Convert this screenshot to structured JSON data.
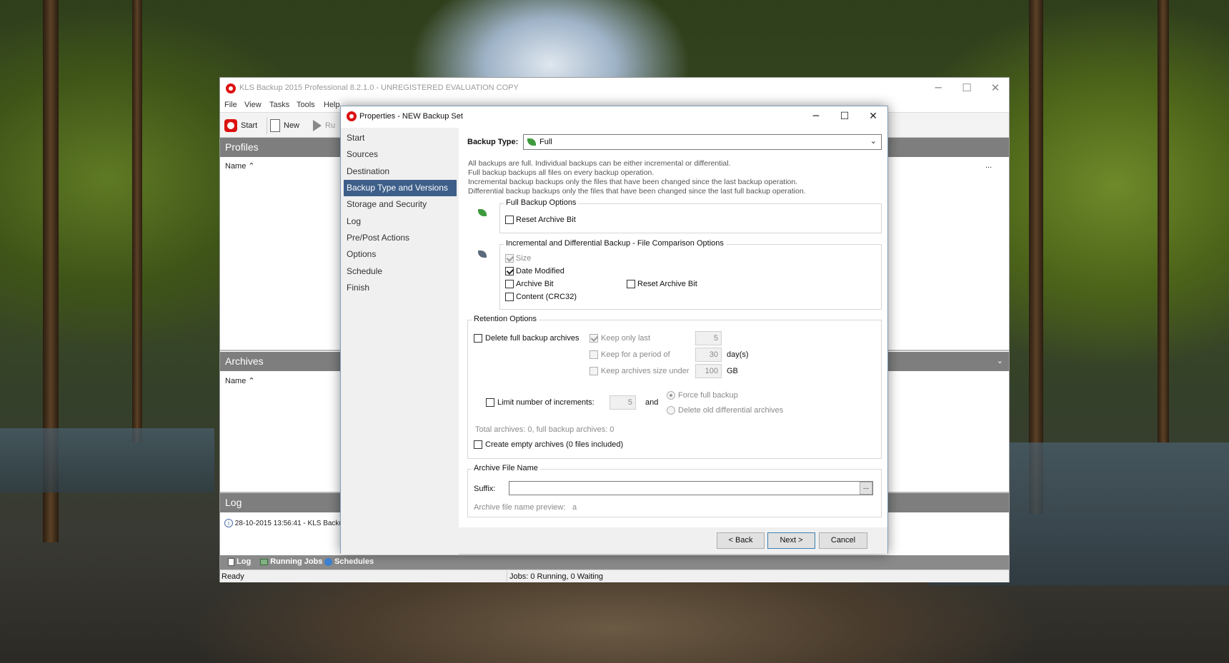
{
  "main_window": {
    "title": "KLS Backup 2015 Professional 8.2.1.0 - UNREGISTERED EVALUATION COPY",
    "menu": [
      "File",
      "View",
      "Tasks",
      "Tools",
      "Help"
    ],
    "toolbar": {
      "start": "Start",
      "new": "New",
      "run": "Ru"
    },
    "profiles": {
      "header": "Profiles",
      "column": "Name",
      "ellipsis": "..."
    },
    "archives": {
      "header": "Archives",
      "column": "Name"
    },
    "log": {
      "header": "Log",
      "entry": "28-10-2015 13:56:41 - KLS Backu"
    },
    "bottom_tabs": [
      "Log",
      "Running Jobs",
      "Schedules"
    ],
    "status": {
      "left": "Ready",
      "jobs": "Jobs: 0 Running, 0 Waiting"
    }
  },
  "dialog": {
    "title": "Properties - NEW Backup Set",
    "nav": [
      "Start",
      "Sources",
      "Destination",
      "Backup Type and Versions",
      "Storage and Security",
      "Log",
      "Pre/Post Actions",
      "Options",
      "Schedule",
      "Finish"
    ],
    "active_nav_index": 3,
    "backup_type": {
      "label": "Backup Type:",
      "value": "Full"
    },
    "description": [
      "All backups are full. Individual backups can be either incremental or differential.",
      "Full backup backups all files on every backup operation.",
      "Incremental backup backups only the files that have been changed since the last backup operation.",
      "Differential backup backups only the files that have been changed since the last full backup operation."
    ],
    "full_backup_options": {
      "title": "Full Backup Options",
      "reset_archive_bit": "Reset Archive Bit",
      "reset_archive_bit_checked": false
    },
    "comparison_options": {
      "title": "Incremental and Differential Backup - File Comparison Options",
      "size": "Size",
      "size_checked": true,
      "date_modified": "Date Modified",
      "date_modified_checked": true,
      "archive_bit": "Archive Bit",
      "archive_bit_checked": false,
      "reset_archive_bit": "Reset Archive Bit",
      "reset_archive_bit_checked": false,
      "content": "Content (CRC32)",
      "content_checked": false
    },
    "retention": {
      "title": "Retention Options",
      "delete_full": "Delete full backup archives",
      "keep_only_last": "Keep only last",
      "keep_only_last_value": "5",
      "keep_only_last_checked": true,
      "keep_period": "Keep for a period of",
      "keep_period_value": "30",
      "keep_period_unit": "day(s)",
      "keep_size": "Keep archives size under",
      "keep_size_value": "100",
      "keep_size_unit": "GB",
      "limit_increments": "Limit number of increments:",
      "limit_increments_value": "5",
      "and": "and",
      "force_full": "Force full backup",
      "delete_old_diff": "Delete old differential archives",
      "totals": "Total archives: 0, full backup archives: 0",
      "create_empty": "Create empty archives (0 files included)"
    },
    "archive_file_name": {
      "title": "Archive File Name",
      "suffix_label": "Suffix:",
      "suffix_value": "",
      "browse": "...",
      "preview_label": "Archive file name preview:",
      "preview_value": "a"
    },
    "buttons": {
      "back": "< Back",
      "next": "Next >",
      "cancel": "Cancel"
    }
  },
  "colors": {
    "nav_active": "#3e5f8a",
    "panel_header": "#7e7e7e",
    "app_red": "#d11111"
  }
}
